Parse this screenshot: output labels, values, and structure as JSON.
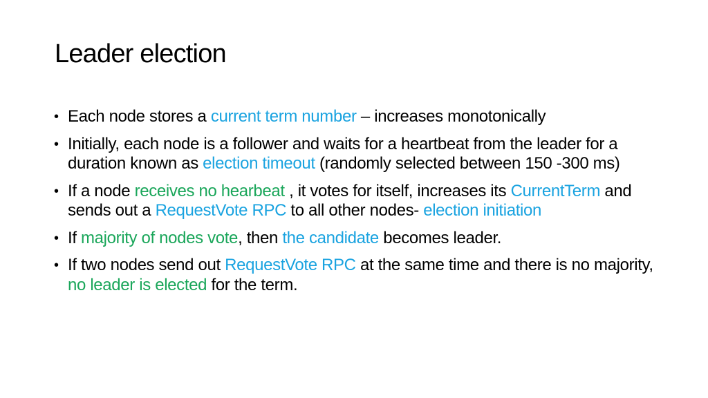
{
  "slide": {
    "title": "Leader election",
    "colors": {
      "text": "#000000",
      "highlight_blue": "#1aa3e0",
      "highlight_green": "#1aa65a",
      "background": "#ffffff"
    },
    "bullet_glyph": "•",
    "bullets": [
      {
        "segments": [
          {
            "text": "Each node stores a ",
            "color": "default"
          },
          {
            "text": "current term number",
            "color": "blue"
          },
          {
            "text": " – increases monotonically",
            "color": "default"
          }
        ]
      },
      {
        "segments": [
          {
            "text": "Initially, each node is a follower and waits for a heartbeat from the leader for a duration known as ",
            "color": "default"
          },
          {
            "text": "election timeout",
            "color": "blue"
          },
          {
            "text": " (randomly selected between 150 -300 ms)",
            "color": "default"
          }
        ]
      },
      {
        "segments": [
          {
            "text": "If a node ",
            "color": "default"
          },
          {
            "text": "receives no hearbeat",
            "color": "green"
          },
          {
            "text": " , it votes for itself, increases its ",
            "color": "default"
          },
          {
            "text": "CurrentTerm",
            "color": "blue"
          },
          {
            "text": " and sends out a ",
            "color": "default"
          },
          {
            "text": "RequestVote RPC",
            "color": "blue"
          },
          {
            "text": " to all other nodes- ",
            "color": "default"
          },
          {
            "text": "election initiation",
            "color": "blue"
          }
        ]
      },
      {
        "segments": [
          {
            "text": "If ",
            "color": "default"
          },
          {
            "text": "majority of nodes vote",
            "color": "green"
          },
          {
            "text": ", then ",
            "color": "default"
          },
          {
            "text": "the candidate",
            "color": "blue"
          },
          {
            "text": " becomes leader.",
            "color": "default"
          }
        ]
      },
      {
        "segments": [
          {
            "text": "If two nodes send out ",
            "color": "default"
          },
          {
            "text": "RequestVote RPC",
            "color": "blue"
          },
          {
            "text": " at the same time and there is no majority, ",
            "color": "default"
          },
          {
            "text": "no leader is elected",
            "color": "green"
          },
          {
            "text": " for the term.",
            "color": "default"
          }
        ]
      }
    ]
  }
}
